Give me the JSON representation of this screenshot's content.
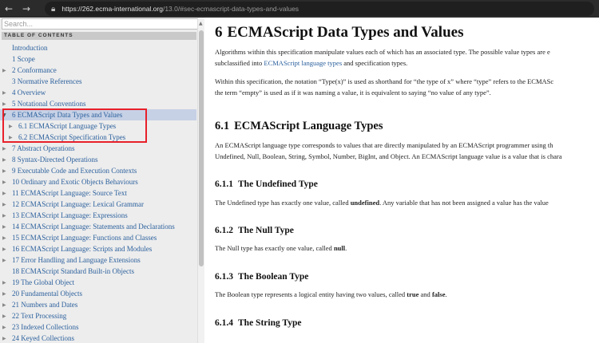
{
  "browser": {
    "url_host": "https://262.ecma-international.org",
    "url_path": "/13.0/#sec-ecmascript-data-types-and-values"
  },
  "sidebar": {
    "search_placeholder": "Search...",
    "toc_heading": "TABLE OF CONTENTS",
    "items": [
      {
        "label": "Introduction",
        "arrow": ""
      },
      {
        "label": "1 Scope",
        "arrow": ""
      },
      {
        "label": "2 Conformance",
        "arrow": "▶"
      },
      {
        "label": "3 Normative References",
        "arrow": ""
      },
      {
        "label": "4 Overview",
        "arrow": "▶"
      },
      {
        "label": "5 Notational Conventions",
        "arrow": "▶"
      },
      {
        "label": "6 ECMAScript Data Types and Values",
        "arrow": "▼"
      },
      {
        "label": "6.1 ECMAScript Language Types",
        "arrow": "▶"
      },
      {
        "label": "6.2 ECMAScript Specification Types",
        "arrow": "▶"
      },
      {
        "label": "7 Abstract Operations",
        "arrow": "▶"
      },
      {
        "label": "8 Syntax-Directed Operations",
        "arrow": "▶"
      },
      {
        "label": "9 Executable Code and Execution Contexts",
        "arrow": "▶"
      },
      {
        "label": "10 Ordinary and Exotic Objects Behaviours",
        "arrow": "▶"
      },
      {
        "label": "11 ECMAScript Language: Source Text",
        "arrow": "▶"
      },
      {
        "label": "12 ECMAScript Language: Lexical Grammar",
        "arrow": "▶"
      },
      {
        "label": "13 ECMAScript Language: Expressions",
        "arrow": "▶"
      },
      {
        "label": "14 ECMAScript Language: Statements and Declarations",
        "arrow": "▶"
      },
      {
        "label": "15 ECMAScript Language: Functions and Classes",
        "arrow": "▶"
      },
      {
        "label": "16 ECMAScript Language: Scripts and Modules",
        "arrow": "▶"
      },
      {
        "label": "17 Error Handling and Language Extensions",
        "arrow": "▶"
      },
      {
        "label": "18 ECMAScript Standard Built-in Objects",
        "arrow": ""
      },
      {
        "label": "19 The Global Object",
        "arrow": "▶"
      },
      {
        "label": "20 Fundamental Objects",
        "arrow": "▶"
      },
      {
        "label": "21 Numbers and Dates",
        "arrow": "▶"
      },
      {
        "label": "22 Text Processing",
        "arrow": "▶"
      },
      {
        "label": "23 Indexed Collections",
        "arrow": "▶"
      },
      {
        "label": "24 Keyed Collections",
        "arrow": "▶"
      }
    ]
  },
  "content": {
    "h1_num": "6",
    "h1_title": "ECMAScript Data Types and Values",
    "p1a": "Algorithms within this specification manipulate values each of which has an associated type. The possible value types are e",
    "p1b_pre": "subclassified into ",
    "p1b_link": "ECMAScript language types",
    "p1b_post": " and specification types.",
    "p2a": "Within this specification, the notation “Type(x)” is used as shorthand for “the type of x” where “type” refers to the ECMASc",
    "p2b": "the term “empty” is used as if it was naming a value, it is equivalent to saying “no value of any type”.",
    "h2_num": "6.1",
    "h2_title": "ECMAScript Language Types",
    "p3a": "An ECMAScript language type corresponds to values that are directly manipulated by an ECMAScript programmer using th",
    "p3b": "Undefined, Null, Boolean, String, Symbol, Number, BigInt, and Object. An ECMAScript language value is a value that is chara",
    "h3_1_num": "6.1.1",
    "h3_1_title": "The Undefined Type",
    "p4_pre": "The Undefined type has exactly one value, called ",
    "p4_bold": "undefined",
    "p4_post": ". Any variable that has not been assigned a value has the value",
    "h3_2_num": "6.1.2",
    "h3_2_title": "The Null Type",
    "p5_pre": "The Null type has exactly one value, called ",
    "p5_bold": "null",
    "p5_post": ".",
    "h3_3_num": "6.1.3",
    "h3_3_title": "The Boolean Type",
    "p6_pre": "The Boolean type represents a logical entity having two values, called ",
    "p6_bold1": "true",
    "p6_mid": " and ",
    "p6_bold2": "false",
    "p6_post": ".",
    "h3_4_num": "6.1.4",
    "h3_4_title": "The String Type"
  }
}
